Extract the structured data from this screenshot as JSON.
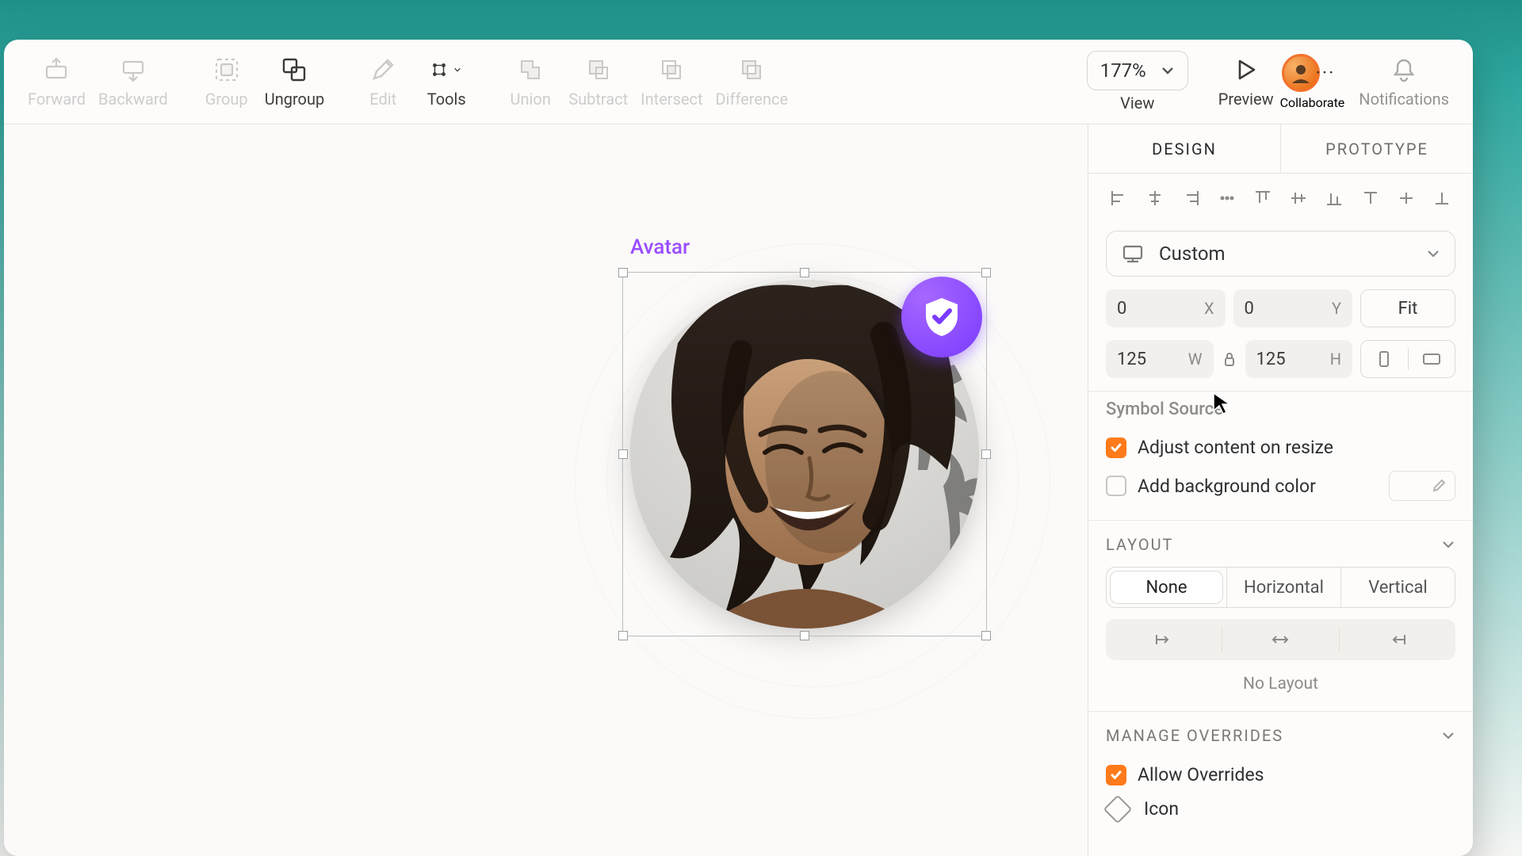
{
  "toolbar": {
    "forward": "Forward",
    "backward": "Backward",
    "group": "Group",
    "ungroup": "Ungroup",
    "edit": "Edit",
    "tools": "Tools",
    "union": "Union",
    "subtract": "Subtract",
    "intersect": "Intersect",
    "difference": "Difference",
    "zoom": "177%",
    "view": "View",
    "preview": "Preview",
    "collaborate": "Collaborate",
    "notifications": "Notifications"
  },
  "canvas": {
    "selection_label": "Avatar"
  },
  "inspector": {
    "tabs": {
      "design": "DESIGN",
      "prototype": "PROTOTYPE"
    },
    "preset": "Custom",
    "x": "0",
    "y": "0",
    "x_suffix": "X",
    "y_suffix": "Y",
    "fit": "Fit",
    "w": "125",
    "h": "125",
    "w_suffix": "W",
    "h_suffix": "H",
    "symbol_source_title": "Symbol Source",
    "adjust_label": "Adjust content on resize",
    "bgcolor_label": "Add background color",
    "layout_title": "LAYOUT",
    "layout_opts": {
      "none": "None",
      "horizontal": "Horizontal",
      "vertical": "Vertical"
    },
    "no_layout": "No Layout",
    "overrides_title": "MANAGE OVERRIDES",
    "allow_overrides": "Allow Overrides",
    "icon_row": "Icon"
  }
}
